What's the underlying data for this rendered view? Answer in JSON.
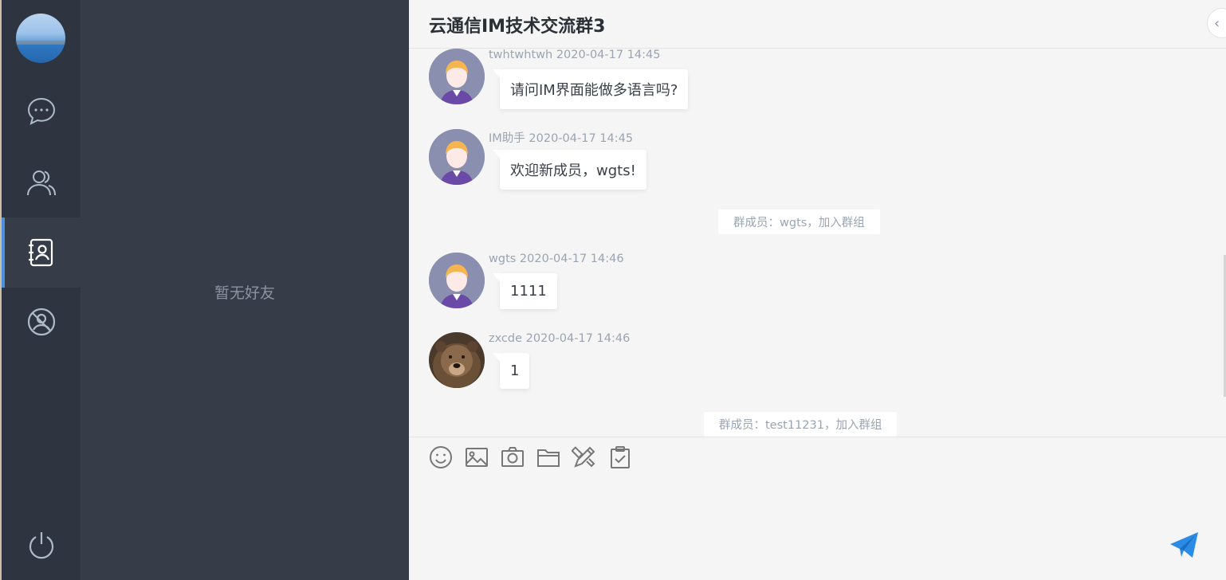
{
  "nav": {
    "items": [
      {
        "icon": "chat-bubble-icon",
        "active": false
      },
      {
        "icon": "users-icon",
        "active": false
      },
      {
        "icon": "contacts-book-icon",
        "active": true
      },
      {
        "icon": "user-circle-icon",
        "active": false
      }
    ],
    "logout_icon": "power-icon",
    "accent": "#4a90e2"
  },
  "friends": {
    "empty_text": "暂无好友"
  },
  "chat": {
    "title": "云通信IM技术交流群3",
    "messages": [
      {
        "sender": "twhtwhtwh",
        "time": "2020-04-17 14:45",
        "text": "请问IM界面能做多语言吗?",
        "avatar": "cartoon-avatar"
      },
      {
        "sender": "IM助手",
        "time": "2020-04-17 14:45",
        "text": "欢迎新成员，wgts!",
        "avatar": "cartoon-avatar"
      },
      {
        "system": "群成员：wgts，加入群组"
      },
      {
        "sender": "wgts",
        "time": "2020-04-17 14:46",
        "text": "1111",
        "avatar": "cartoon-avatar"
      },
      {
        "sender": "zxcde",
        "time": "2020-04-17 14:46",
        "text": "1",
        "avatar": "bear-photo"
      },
      {
        "system": "群成员：test11231，加入群组"
      }
    ],
    "toolbar": [
      "emoji-icon",
      "image-icon",
      "camera-icon",
      "folder-icon",
      "draw-tools-icon",
      "clipboard-check-icon"
    ],
    "send_icon": "send-icon",
    "send_color": "#2b8ce8"
  }
}
